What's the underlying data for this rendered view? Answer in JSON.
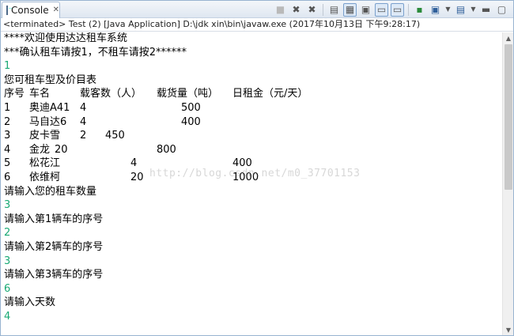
{
  "tab": {
    "label": "Console",
    "close_icon": "close-icon",
    "icon": "console-icon"
  },
  "toolbar": {
    "icons": [
      "stop-icon",
      "remove-launch-icon",
      "remove-all-icon",
      "scroll-lock-icon",
      "word-wrap-icon",
      "show-stdout-icon",
      "show-stderr-icon",
      "pin-console-icon",
      "display-console-icon",
      "open-console-icon",
      "view-menu-icon"
    ]
  },
  "status": "<terminated> Test (2) [Java Application] D:\\jdk xin\\bin\\javaw.exe (2017年10月13日 下午9:28:17)",
  "console": {
    "line1": "****欢迎使用达达租车系统",
    "line2": "***确认租车请按1，不租车请按2******",
    "input1": "1",
    "line4": "您可租车型及价目表",
    "header": {
      "c1": "序号",
      "c2": "车名",
      "c3": "载客数（人）",
      "c4": "载货量（吨）",
      "c5": "日租金（元/天）"
    },
    "rows": [
      {
        "no": "1",
        "name": "奥迪A41",
        "a": "4",
        "b": "500",
        "c": ""
      },
      {
        "no": "2",
        "name": "马自达6",
        "a": "4",
        "b": "400",
        "c": ""
      },
      {
        "no": "3",
        "name": "皮卡雪",
        "a": "2",
        "b": "450",
        "c": ""
      },
      {
        "no": "4",
        "name": "金龙",
        "a": "20",
        "b": "800",
        "c": ""
      },
      {
        "no": "5",
        "name": "松花江",
        "a": "4",
        "b": "400",
        "c": ""
      },
      {
        "no": "6",
        "name": "依维柯",
        "a": "20",
        "b": "1000",
        "c": ""
      }
    ],
    "prompt_count": "请输入您的租车数量",
    "input_count": "3",
    "prompt1": "请输入第1辆车的序号",
    "input_1": "2",
    "prompt2": "请输入第2辆车的序号",
    "input_2": "3",
    "prompt3": "请输入第3辆车的序号",
    "input_3": "6",
    "prompt_days": "请输入天数",
    "input_days": "4"
  },
  "watermark": "http://blog.csdn.net/m0_37701153",
  "colors": {
    "input": "#19a974",
    "accent": "#99b4d1"
  }
}
